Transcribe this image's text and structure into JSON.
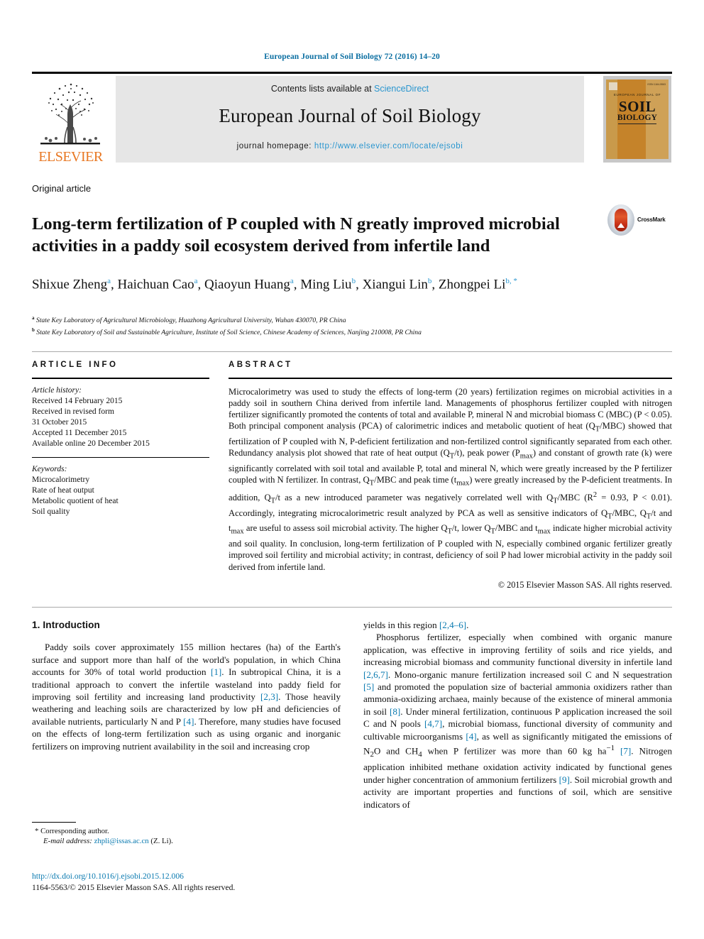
{
  "running_head": "European Journal of Soil Biology 72 (2016) 14–20",
  "masthead": {
    "contents_prefix": "Contents lists available at ",
    "contents_link": "ScienceDirect",
    "journal_title": "European Journal of Soil Biology",
    "homepage_label": "journal homepage: ",
    "homepage_url": "http://www.elsevier.com/locate/ejsobi",
    "publisher_logo_text": "ELSEVIER",
    "cover": {
      "eyebrow": "EUROPEAN JOURNAL OF",
      "line1": "SOIL",
      "line2": "BIOLOGY",
      "corner_code": "ISSN 1164-5563"
    }
  },
  "article": {
    "type": "Original article",
    "title": "Long-term fertilization of P coupled with N greatly improved microbial activities in a paddy soil ecosystem derived from infertile land",
    "crossmark_label": "CrossMark",
    "authors": [
      {
        "name": "Shixue Zheng",
        "sup": "a"
      },
      {
        "name": "Haichuan Cao",
        "sup": "a"
      },
      {
        "name": "Qiaoyun Huang",
        "sup": "a"
      },
      {
        "name": "Ming Liu",
        "sup": "b"
      },
      {
        "name": "Xiangui Lin",
        "sup": "b"
      },
      {
        "name": "Zhongpei Li",
        "sup": "b, *"
      }
    ],
    "affiliations": [
      {
        "marker": "a",
        "text": "State Key Laboratory of Agricultural Microbiology, Huazhong Agricultural University, Wuhan 430070, PR China"
      },
      {
        "marker": "b",
        "text": "State Key Laboratory of Soil and Sustainable Agriculture, Institute of Soil Science, Chinese Academy of Sciences, Nanjing 210008, PR China"
      }
    ]
  },
  "article_info": {
    "heading": "ARTICLE INFO",
    "history_label": "Article history:",
    "history": [
      "Received 14 February 2015",
      "Received in revised form",
      "31 October 2015",
      "Accepted 11 December 2015",
      "Available online 20 December 2015"
    ],
    "keywords_label": "Keywords:",
    "keywords": [
      "Microcalorimetry",
      "Rate of heat output",
      "Metabolic quotient of heat",
      "Soil quality"
    ]
  },
  "abstract": {
    "heading": "ABSTRACT",
    "paragraph_1": "Microcalorimetry was used to study the effects of long-term (20 years) fertilization regimes on microbial activities in a paddy soil in southern China derived from infertile land. Managements of phosphorus fertilizer coupled with nitrogen fertilizer significantly promoted the contents of total and available P, mineral N and microbial biomass C (MBC) (P < 0.05). Both principal component analysis (PCA) of calorimetric indices and metabolic quotient of heat (Q",
    "fragment_2": "/MBC) showed that fertilization of P coupled with N, P-deficient fertilization and non-fertilized control significantly separated from each other. Redundancy analysis plot showed that rate of heat output (Q",
    "fragment_3": "/t), peak power (P",
    "fragment_4": ") and constant of growth rate (k) were significantly correlated with soil total and available P, total and mineral N, which were greatly increased by the P fertilizer coupled with N fertilizer. In contrast, Q",
    "fragment_5": "/MBC and peak time (t",
    "fragment_6": ") were greatly increased by the P-deficient treatments. In addition, Q",
    "fragment_7": "/t as a new introduced parameter was negatively correlated well with Q",
    "fragment_8": "/MBC (R",
    "fragment_9": " = 0.93, P < 0.01). Accordingly, integrating microcalorimetric result analyzed by PCA as well as sensitive indicators of Q",
    "fragment_10": "/MBC, Q",
    "fragment_11": "/t and t",
    "fragment_12": " are useful to assess soil microbial activity. The higher Q",
    "fragment_13": "/t, lower Q",
    "fragment_14": "/MBC and t",
    "fragment_15": " indicate higher microbial activity and soil quality. In conclusion, long-term fertilization of P coupled with N, especially combined organic fertilizer greatly improved soil fertility and microbial activity; in contrast, deficiency of soil P had lower microbial activity in the paddy soil derived from infertile land.",
    "sub_T": "T",
    "sub_max": "max",
    "sup_2": "2",
    "copyright": "© 2015 Elsevier Masson SAS. All rights reserved."
  },
  "body": {
    "section_number_title": "1. Introduction",
    "left_paragraph_1_a": "Paddy soils cover approximately 155 million hectares (ha) of the Earth's surface and support more than half of the world's population, in which China accounts for 30% of total world production ",
    "ref_1": "[1]",
    "left_paragraph_1_b": ". In subtropical China, it is a traditional approach to convert the infertile wasteland into paddy field for improving soil fertility and increasing land productivity ",
    "ref_2_3": "[2,3]",
    "left_paragraph_1_c": ". Those heavily weathering and leaching soils are characterized by low pH and deficiencies of available nutrients, particularly N and P ",
    "ref_4": "[4]",
    "left_paragraph_1_d": ". Therefore, many studies have focused on the effects of long-term fertilization such as using organic and inorganic fertilizers on improving nutrient availability in the soil and increasing crop ",
    "right_carryover_a": "yields in this region ",
    "ref_2_4_6": "[2,4–6]",
    "right_carryover_b": ".",
    "right_paragraph_1_a": "Phosphorus fertilizer, especially when combined with organic manure application, was effective in improving fertility of soils and rice yields, and increasing microbial biomass and community functional diversity in infertile land ",
    "ref_2_6_7": "[2,6,7]",
    "right_paragraph_1_b": ". Mono-organic manure fertilization increased soil C and N sequestration ",
    "ref_5": "[5]",
    "right_paragraph_1_c": " and promoted the population size of bacterial ammonia oxidizers rather than ammonia-oxidizing archaea, mainly because of the existence of mineral ammonia in soil ",
    "ref_8": "[8]",
    "right_paragraph_1_d": ". Under mineral fertilization, continuous P application increased the soil C and N pools ",
    "ref_4_7": "[4,7]",
    "right_paragraph_1_e": ", microbial biomass, functional diversity of community and cultivable microorganisms ",
    "ref_4_b": "[4]",
    "right_paragraph_1_f": ", as well as significantly mitigated the emissions of N",
    "sub_2": "2",
    "right_paragraph_1_g": "O and CH",
    "sub_4": "4",
    "right_paragraph_1_h": " when P fertilizer was more than 60 kg ha",
    "sup_minus1": "−1",
    "right_paragraph_1_i": " ",
    "ref_7": "[7]",
    "right_paragraph_1_j": ". Nitrogen application inhibited methane oxidation activity indicated by functional genes under higher concentration of ammonium fertilizers ",
    "ref_9": "[9]",
    "right_paragraph_1_k": ". Soil microbial growth and activity are important properties and functions of soil, which are sensitive indicators of"
  },
  "footer": {
    "corresponding_marker": "*",
    "corresponding_label": "Corresponding author.",
    "email_label": "E-mail address:",
    "email": "zhpli@issas.ac.cn",
    "email_owner": "(Z. Li).",
    "doi_url": "http://dx.doi.org/10.1016/j.ejsobi.2015.12.006",
    "issn_line": "1164-5563/© 2015 Elsevier Masson SAS. All rights reserved."
  },
  "colors": {
    "link_blue": "#0a7ab0",
    "sciencedirect_blue": "#2a96cf",
    "elsevier_orange": "#e87722",
    "banner_gray": "#e6e6e6"
  }
}
